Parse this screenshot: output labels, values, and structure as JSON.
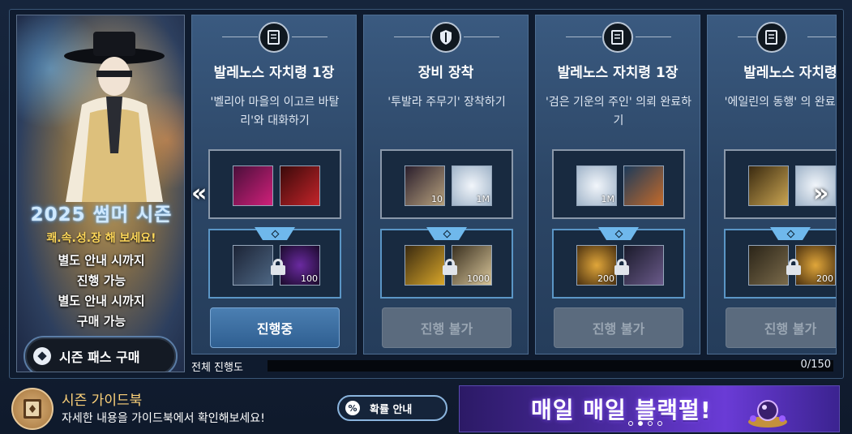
{
  "banner": {
    "title": "2025 썸머 시즌",
    "slogan": "쾌.속.성.장 해 보세요!",
    "lines": [
      "별도 안내 시까지",
      "진행 가능",
      "별도 안내 시까지",
      "구매 가능"
    ],
    "buy_label": "시즌 패스 구매"
  },
  "nav": {
    "prev": "«",
    "next": "»"
  },
  "cards": [
    {
      "title": "발레노스 자치령 1장",
      "desc": "'벨리아 마을의 이고르 바탈리'와 대화하기",
      "emblem": "scroll-icon",
      "top_items": [
        {
          "name": "pink-weapon-item",
          "qty": ""
        },
        {
          "name": "red-gift-box-item",
          "qty": ""
        }
      ],
      "bottom_items": [
        {
          "name": "treasure-chest-item",
          "qty": ""
        },
        {
          "name": "purple-orb-item",
          "qty": "100"
        }
      ],
      "action": "진행중",
      "state": "active"
    },
    {
      "title": "장비 장착",
      "desc": "'투발라 주무기' 장착하기",
      "emblem": "shield-sword-icon",
      "top_items": [
        {
          "name": "scroll-quill-item",
          "qty": "10"
        },
        {
          "name": "silver-coin-item",
          "qty": "1M"
        }
      ],
      "bottom_items": [
        {
          "name": "gold-ticket-item",
          "qty": ""
        },
        {
          "name": "parchment-item",
          "qty": "1000"
        }
      ],
      "action": "진행 불가",
      "state": "disabled"
    },
    {
      "title": "발레노스 자치령 1장",
      "desc": "'검은 기운의 주인' 의뢰 완료하기",
      "emblem": "scroll-icon",
      "top_items": [
        {
          "name": "silver-coin-item",
          "qty": "1M"
        },
        {
          "name": "blue-ticket-item",
          "qty": ""
        }
      ],
      "bottom_items": [
        {
          "name": "pet-food-bowl-item",
          "qty": "200"
        },
        {
          "name": "creature-item",
          "qty": ""
        }
      ],
      "action": "진행 불가",
      "state": "disabled"
    },
    {
      "title": "발레노스 자치령",
      "desc": "'에일린의 동행' 의 완료하기",
      "emblem": "scroll-icon",
      "top_items": [
        {
          "name": "gold-chest-item",
          "qty": ""
        },
        {
          "name": "silver-coin-item",
          "qty": ""
        }
      ],
      "bottom_items": [
        {
          "name": "wooden-chest-item",
          "qty": ""
        },
        {
          "name": "pet-food-bowl-item",
          "qty": "200"
        }
      ],
      "action": "진행 불가",
      "state": "disabled"
    }
  ],
  "progress": {
    "label": "전체 진행도",
    "value": "0/150",
    "fraction": 0
  },
  "guide": {
    "title": "시즌 가이드북",
    "subtitle": "자세한 내용을 가이드북에서 확인해보세요!"
  },
  "probability": {
    "icon": "%",
    "label": "확률 안내"
  },
  "promo": {
    "text": "매일 매일 블랙펄!"
  },
  "colors": {
    "accent": "#6fb8ec",
    "gold_text": "#ffd37a",
    "active_button": "#3c6fa3",
    "disabled_button": "#5b6b7e"
  }
}
